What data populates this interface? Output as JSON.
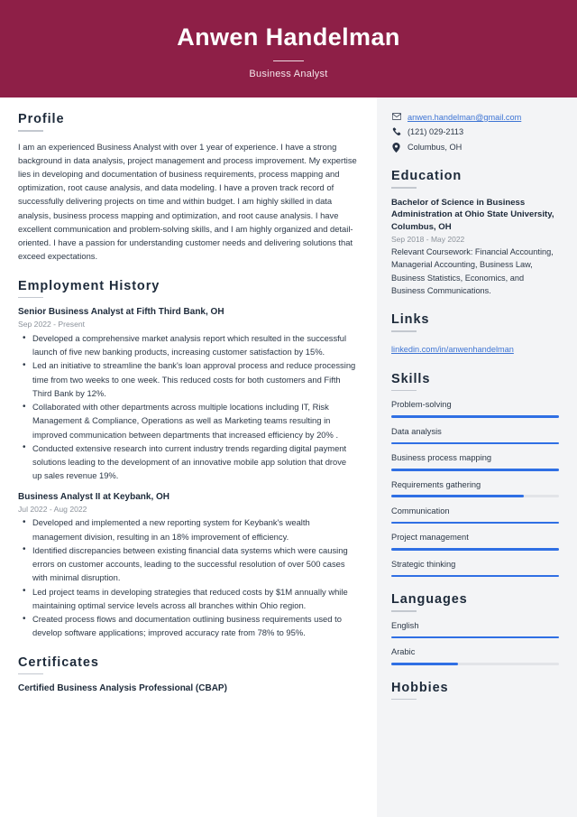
{
  "header": {
    "name": "Anwen Handelman",
    "job_title": "Business Analyst",
    "background_color": "#8e1f47"
  },
  "accent_colors": {
    "bar_fill": "#2f6fe4",
    "bar_track": "#e2e4e8",
    "link": "#3d74d4",
    "heading": "#1d2a3a"
  },
  "main": {
    "profile": {
      "heading": "Profile",
      "text": "I am an experienced Business Analyst with over 1 year of experience. I have a strong background in data analysis, project management and process improvement. My expertise lies in developing and documentation of business requirements, process mapping and optimization, root cause analysis, and data modeling. I have a proven track record of successfully delivering projects on time and within budget. I am highly skilled in data analysis, business process mapping and optimization, and root cause analysis. I have excellent communication and problem-solving skills, and I am highly organized and detail-oriented. I have a passion for understanding customer needs and delivering solutions that exceed expectations."
    },
    "employment": {
      "heading": "Employment History",
      "jobs": [
        {
          "title": "Senior Business Analyst at Fifth Third Bank, OH",
          "date": "Sep 2022 - Present",
          "bullets": [
            "Developed a comprehensive market analysis report which resulted in the successful launch of five new banking products, increasing customer satisfaction by 15%.",
            "Led an initiative to streamline the bank's loan approval process and reduce processing time from two weeks to one week. This reduced costs for both customers and Fifth Third Bank by 12%.",
            "Collaborated with other departments across multiple locations including IT, Risk Management & Compliance, Operations as well as Marketing teams resulting in improved communication between departments that increased efficiency by 20% .",
            "Conducted extensive research into current industry trends regarding digital payment solutions leading to the development of an innovative mobile app solution that drove up sales revenue 19%."
          ]
        },
        {
          "title": "Business Analyst II at Keybank, OH",
          "date": "Jul 2022 - Aug 2022",
          "bullets": [
            "Developed and implemented a new reporting system for Keybank's wealth management division, resulting in an 18% improvement of efficiency.",
            "Identified discrepancies between existing financial data systems which were causing errors on customer accounts, leading to the successful resolution of over 500 cases with minimal disruption.",
            "Led project teams in developing strategies that reduced costs by $1M annually while maintaining optimal service levels across all branches within Ohio region.",
            "Created process flows and documentation outlining business requirements used to develop software applications; improved accuracy rate from 78% to 95%."
          ]
        }
      ]
    },
    "certificates": {
      "heading": "Certificates",
      "items": [
        {
          "title": "Certified Business Analysis Professional (CBAP)"
        }
      ]
    }
  },
  "sidebar": {
    "contact": [
      {
        "icon": "envelope-icon",
        "text": "anwen.handelman@gmail.com",
        "is_link": true
      },
      {
        "icon": "phone-icon",
        "text": "(121) 029-2113",
        "is_link": false
      },
      {
        "icon": "location-pin-icon",
        "text": "Columbus, OH",
        "is_link": false
      }
    ],
    "education": {
      "heading": "Education",
      "items": [
        {
          "degree": "Bachelor of Science in Business Administration at Ohio State University, Columbus, OH",
          "date": "Sep 2018 - May 2022",
          "description": "Relevant Coursework: Financial Accounting, Managerial Accounting, Business Law, Business Statistics, Economics, and Business Communications."
        }
      ]
    },
    "links": {
      "heading": "Links",
      "items": [
        {
          "label": "linkedin.com/in/anwenhandelman"
        }
      ]
    },
    "skills": {
      "heading": "Skills",
      "items": [
        {
          "label": "Problem-solving",
          "level": 100
        },
        {
          "label": "Data analysis",
          "level": 100
        },
        {
          "label": "Business process mapping",
          "level": 100
        },
        {
          "label": "Requirements gathering",
          "level": 79
        },
        {
          "label": "Communication",
          "level": 100
        },
        {
          "label": "Project management",
          "level": 100
        },
        {
          "label": "Strategic thinking",
          "level": 100
        }
      ]
    },
    "languages": {
      "heading": "Languages",
      "items": [
        {
          "label": "English",
          "level": 100
        },
        {
          "label": "Arabic",
          "level": 40
        }
      ]
    },
    "hobbies": {
      "heading": "Hobbies"
    }
  }
}
